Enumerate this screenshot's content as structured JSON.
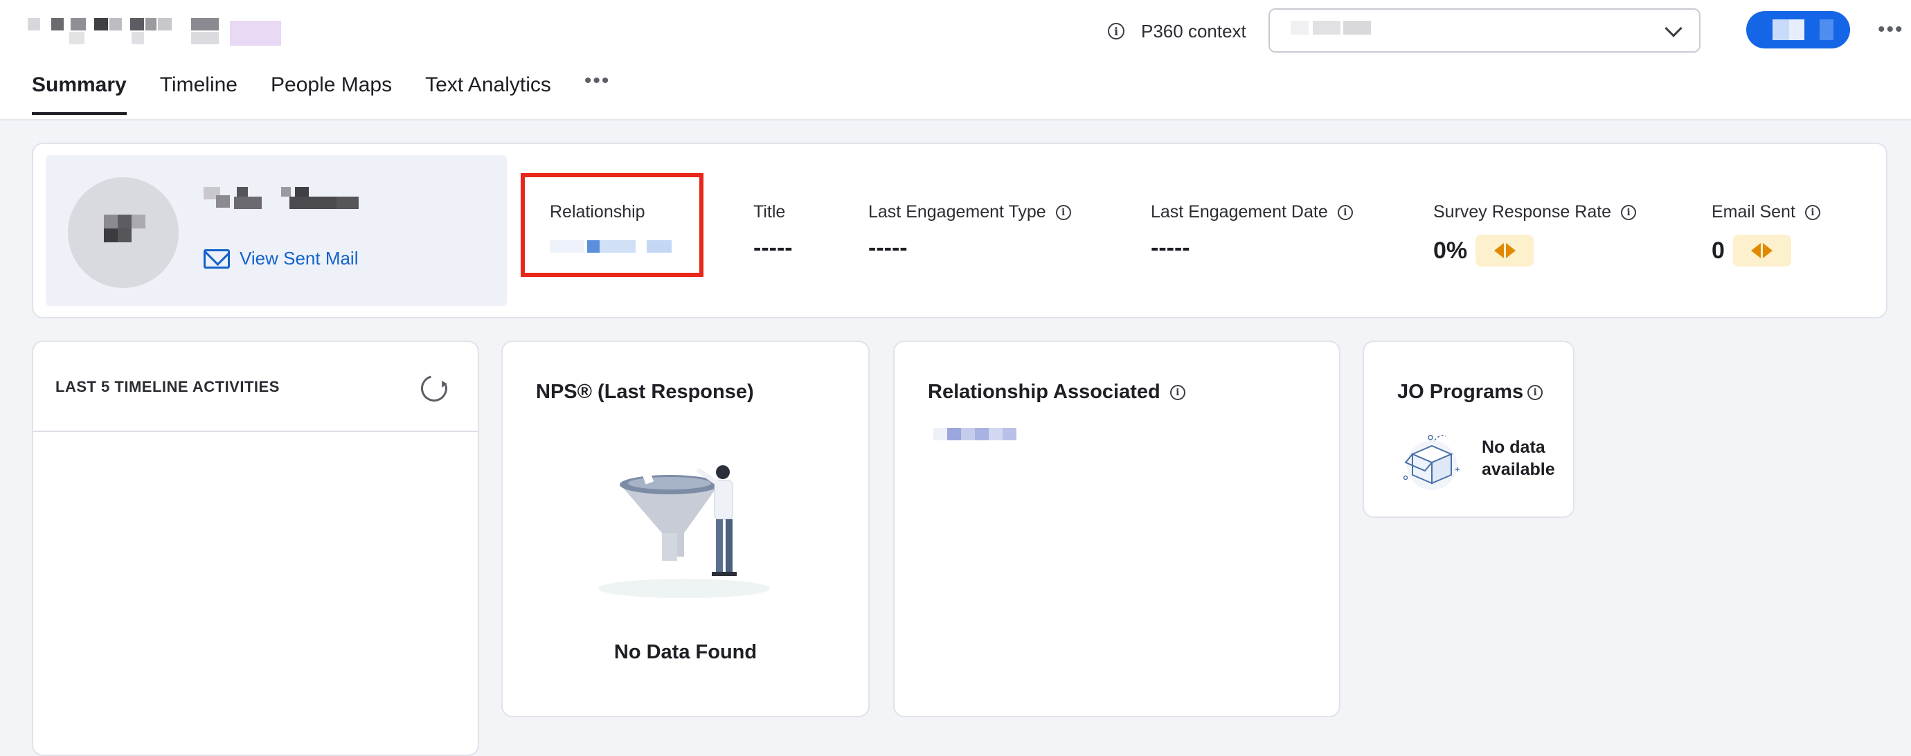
{
  "header": {
    "context_label": "P360 context",
    "tabs": [
      {
        "label": "Summary",
        "active": true
      },
      {
        "label": "Timeline",
        "active": false
      },
      {
        "label": "People Maps",
        "active": false
      },
      {
        "label": "Text Analytics",
        "active": false
      }
    ],
    "more_label": "•••",
    "header_more_label": "•••"
  },
  "profile": {
    "view_sent_mail_label": "View Sent Mail"
  },
  "metrics": {
    "relationship_label": "Relationship",
    "title_label": "Title",
    "title_value": "-----",
    "last_engagement_type_label": "Last Engagement Type",
    "last_engagement_type_value": "-----",
    "last_engagement_date_label": "Last Engagement Date",
    "last_engagement_date_value": "-----",
    "survey_response_rate_label": "Survey Response Rate",
    "survey_response_rate_value": "0%",
    "email_sent_label": "Email Sent",
    "email_sent_value": "0"
  },
  "cards": {
    "timeline_title": "LAST 5 TIMELINE ACTIVITIES",
    "nps_title": "NPS® (Last Response)",
    "nps_empty": "No Data Found",
    "relationship_associated_title": "Relationship Associated",
    "jo_programs_title": "JO Programs",
    "jo_empty_line1": "No data",
    "jo_empty_line2": "available"
  },
  "colors": {
    "accent_blue": "#1466e6",
    "link_blue": "#1262c9",
    "highlight_red": "#e8261a",
    "trend_bg": "#fdf0cd",
    "trend_arrow": "#e08a00"
  },
  "icons": [
    "info-icon",
    "chevron-down-icon",
    "more-icon",
    "mail-icon",
    "refresh-icon",
    "trend-neutral-icon",
    "empty-funnel-illustration",
    "empty-box-icon"
  ]
}
